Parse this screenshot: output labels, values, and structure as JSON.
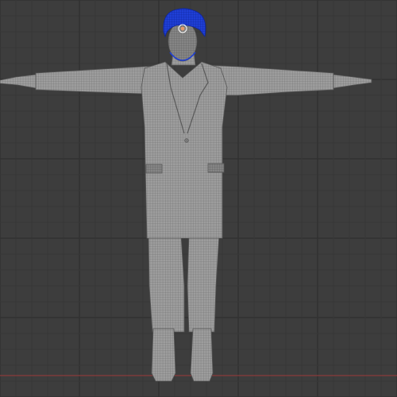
{
  "viewport": {
    "view": "front-orthographic",
    "grid": true,
    "colors": {
      "background": "#3d3d3d",
      "grid_minor": "#373737",
      "grid_major": "#303030",
      "x_axis": "#8a3b3b",
      "mesh_fill": "#9a9a9a",
      "mesh_wire": "#6e6e6e",
      "hair_selected": "#1f3fd6",
      "origin_marker": "#e89a6a"
    }
  },
  "scene": {
    "object": "character-mesh",
    "pose": "t-pose",
    "parts": [
      "head",
      "hair",
      "beard",
      "long-coat",
      "trousers",
      "boots",
      "hands"
    ],
    "selected_part": "hair"
  }
}
